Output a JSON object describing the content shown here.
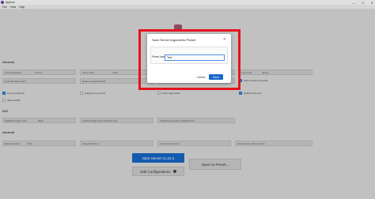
{
  "window": {
    "title": "Appium"
  },
  "menu": [
    "File",
    "View",
    "Help"
  ],
  "sections": {
    "general": "General",
    "ios": "iOS",
    "android": "Android"
  },
  "fields": {
    "server_address": {
      "label": "Server Address",
      "value": "0.0.0.0"
    },
    "server_port": {
      "label": "Server Port",
      "value": "4723"
    },
    "log_path": {
      "label": "Log Path",
      "value": ""
    },
    "log_level": {
      "label": "Log Level",
      "value": "debug"
    },
    "override_temp_path": {
      "label": "Override Temp Path",
      "value": ""
    },
    "node_config_file_path": {
      "label": "Node Config File Path",
      "value": ""
    },
    "default_capabilities": {
      "label": "Default Capabilities",
      "value": ""
    },
    "allow_session_override": {
      "label": "Allow Session Override",
      "value": ""
    },
    "webdriveragent_port": {
      "label": "WebDriverAgent Port",
      "value": "8100"
    },
    "wda_callback_host": {
      "label": "webDriverAgentUrl Callback Host",
      "value": ""
    },
    "wda_callback_port": {
      "label": "webDriverAgentUrl Callback Port",
      "value": ""
    },
    "bootstrap_port": {
      "label": "Bootstrap Port",
      "value": "4724"
    },
    "selendroid_port": {
      "label": "Selendroid Port",
      "value": ""
    },
    "chromedriver_port": {
      "label": "Chromedriver Port",
      "value": ""
    },
    "chromedriver_binary_path": {
      "label": "Chromedriver Binary Path",
      "value": ""
    }
  },
  "checks": {
    "log_timestamps": {
      "label": "Log Timestamps",
      "checked": true
    },
    "suppress_log_color": {
      "label": "Suppress Log Color",
      "checked": false
    },
    "strict_caps_mode": {
      "label": "Strict Caps Mode",
      "checked": false
    },
    "relaxed_security": {
      "label": "Relaxed Security",
      "checked": true
    },
    "allow_cors": {
      "label": "Allow CORS",
      "checked": false
    }
  },
  "buttons": {
    "start_server": "Start Server v1.22.3",
    "edit_configurations": "Edit Configurations",
    "save_as_preset": "Save As Preset..."
  },
  "dialog": {
    "title": "Save Server Arguments Preset",
    "preset_label": "Preset name",
    "preset_value": "Test",
    "cancel": "Cancel",
    "save": "Save"
  },
  "window_controls": {
    "minimize": "—",
    "maximize": "☐",
    "close": "✕"
  },
  "dialog_close_glyph": "✕",
  "check_glyph": "✓",
  "colors": {
    "accent": "#1668c9",
    "highlight": "#e4141e",
    "brand": "#6a3fa0"
  }
}
